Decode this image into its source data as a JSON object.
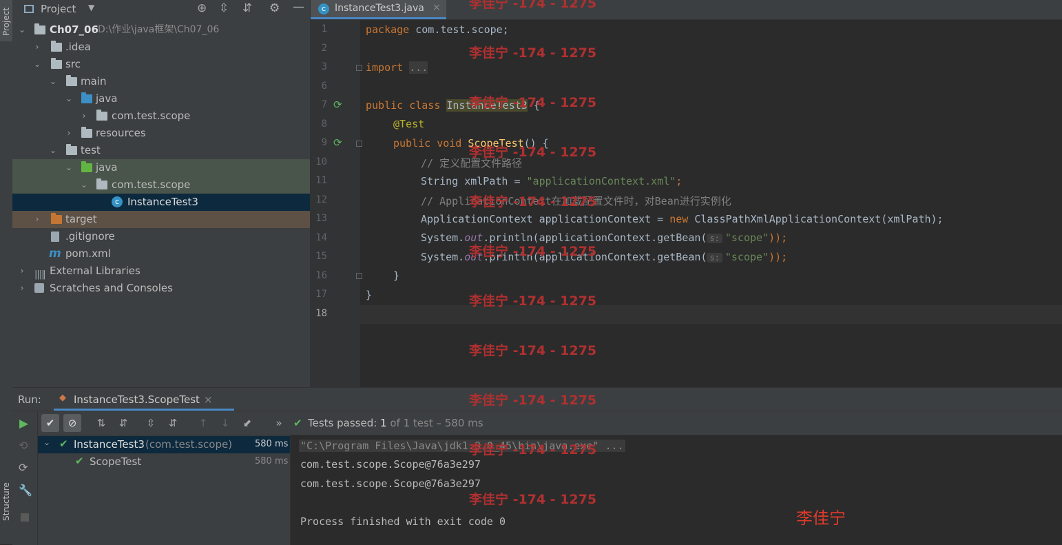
{
  "left_stripe": {
    "project_tab": "Project",
    "structure_tab": "Structure"
  },
  "project_panel": {
    "title": "Project",
    "tree": [
      {
        "label": "Ch07_06",
        "extra": "D:\\作业\\java框架\\Ch07_06"
      },
      {
        "label": ".idea"
      },
      {
        "label": "src"
      },
      {
        "label": "main"
      },
      {
        "label": "java"
      },
      {
        "label": "com.test.scope"
      },
      {
        "label": "resources"
      },
      {
        "label": "test"
      },
      {
        "label": "java"
      },
      {
        "label": "com.test.scope"
      },
      {
        "label": "InstanceTest3"
      },
      {
        "label": "target"
      },
      {
        "label": ".gitignore"
      },
      {
        "label": "pom.xml"
      },
      {
        "label": "External Libraries"
      },
      {
        "label": "Scratches and Consoles"
      }
    ]
  },
  "editor": {
    "tab_label": "InstanceTest3.java",
    "line_numbers": [
      "1",
      "2",
      "3",
      "6",
      "7",
      "8",
      "9",
      "10",
      "11",
      "12",
      "13",
      "14",
      "15",
      "16",
      "17",
      "18"
    ],
    "code": {
      "l1_kw": "package",
      "l1_rest": " com.test.scope;",
      "l3_kw": "import",
      "l3_fold": "...",
      "l7_kw": "public class ",
      "l7_name": "InstanceTest3",
      "l7_rest": " {",
      "l8_ann": "@Test",
      "l9_kw": "public void ",
      "l9_name": "ScopeTest",
      "l9_rest": "() {",
      "l10_cmt": "// 定义配置文件路径",
      "l11_a": "String xmlPath = ",
      "l11_str": "\"applicationContext.xml\"",
      "l11_b": ";",
      "l12_cmt": "// ApplicationContext在加载配置文件时，对Bean进行实例化",
      "l13_a": "ApplicationContext applicationContext = ",
      "l13_kw": "new",
      "l13_b": " ClassPathXmlApplicationContext(xmlPath);",
      "l14_a": "System.",
      "l14_fld": "out",
      "l14_b": ".println(applicationContext.getBean(",
      "l14_hint": "s:",
      "l14_str": "\"scope\"",
      "l14_c": "));",
      "l15_a": "System.",
      "l15_fld": "out",
      "l15_b": ".println(applicationContext.getBean(",
      "l15_hint": "s:",
      "l15_str": "\"scope\"",
      "l15_c": "));",
      "l16": "}",
      "l17": "}"
    }
  },
  "run": {
    "label": "Run:",
    "tab_label": "InstanceTest3.ScopeTest",
    "status_prefix": "Tests passed: ",
    "status_count": "1",
    "status_suffix": " of 1 test – 580 ms",
    "tests": [
      {
        "name": "InstanceTest3",
        "pkg": "(com.test.scope)",
        "time": "580 ms"
      },
      {
        "name": "ScopeTest",
        "pkg": "",
        "time": "580 ms"
      }
    ],
    "console": [
      "\"C:\\Program Files\\Java\\jdk1.8.0_45\\bin\\java.exe\" ...",
      "com.test.scope.Scope@76a3e297",
      "com.test.scope.Scope@76a3e297",
      "",
      "Process finished with exit code 0"
    ]
  },
  "watermarks": {
    "repeated": "李佳宁 -174 - 1275",
    "single": "李佳宁"
  },
  "colors": {
    "selection": "#0d293e",
    "test_folder_bg": "#49544a",
    "target_bg": "#5d5145",
    "pass_green": "#5fb85f",
    "watermark": "#b03030"
  }
}
